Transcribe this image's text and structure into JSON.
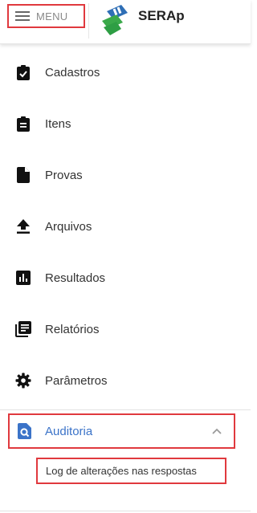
{
  "header": {
    "menu_label": "MENU",
    "app_title": "SERAp",
    "menu_icon": "hamburger-icon",
    "logo_icon": "serap-logo"
  },
  "nav": {
    "items": [
      {
        "label": "Cadastros",
        "icon": "clipboard-check-icon"
      },
      {
        "label": "Itens",
        "icon": "clipboard-list-icon"
      },
      {
        "label": "Provas",
        "icon": "file-icon"
      },
      {
        "label": "Arquivos",
        "icon": "upload-icon"
      },
      {
        "label": "Resultados",
        "icon": "bar-chart-icon"
      },
      {
        "label": "Relatórios",
        "icon": "library-books-icon"
      },
      {
        "label": "Parâmetros",
        "icon": "gear-icon"
      }
    ],
    "auditoria": {
      "label": "Auditoria",
      "icon": "search-document-icon",
      "expanded": true,
      "subitems": [
        {
          "label": "Log de alterações nas respostas"
        }
      ]
    }
  },
  "colors": {
    "accent": "#3b73c8",
    "highlight_border": "#e0393e",
    "logo_green": "#3aa94a",
    "logo_blue": "#2f6fb6"
  }
}
